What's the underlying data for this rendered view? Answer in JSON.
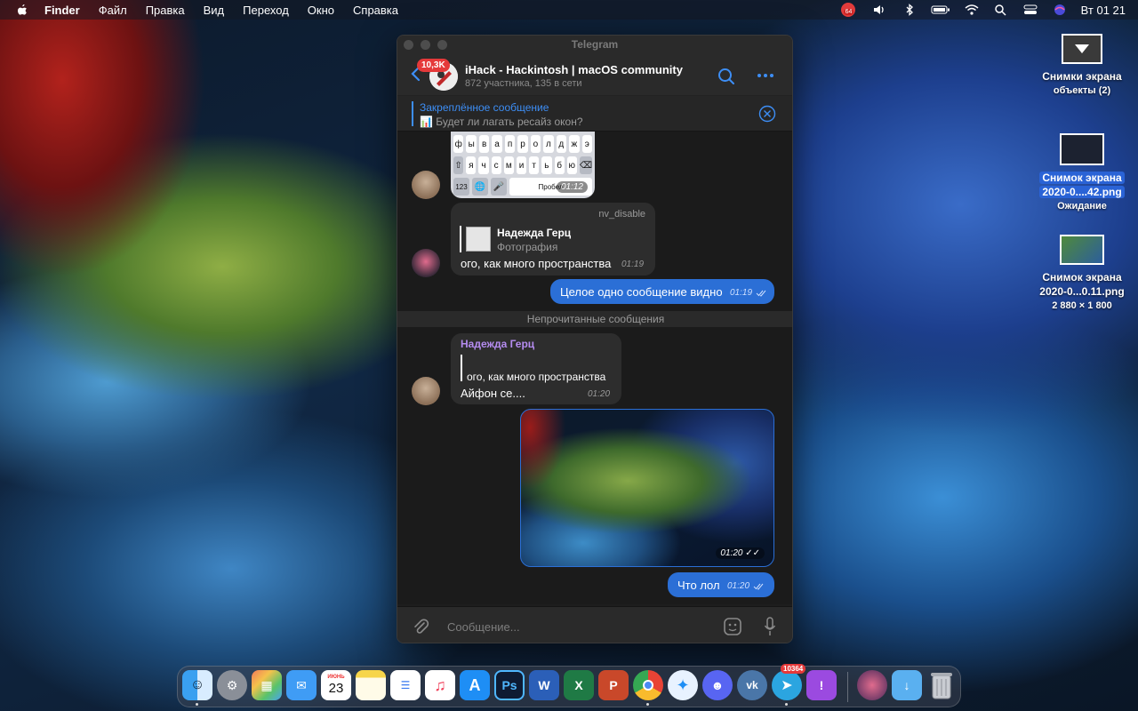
{
  "menubar": {
    "app_name": "Finder",
    "menus": [
      "Файл",
      "Правка",
      "Вид",
      "Переход",
      "Окно",
      "Справка"
    ],
    "badge_count": "64",
    "clock": "Вт 01 21"
  },
  "desktop_icons": [
    {
      "line1": "Снимки экрана",
      "line2": "объекты (2)"
    },
    {
      "line1": "Снимок экрана",
      "line2": "2020-0....42.png",
      "line3": "Ожидание"
    },
    {
      "line1": "Снимок экрана",
      "line2": "2020-0...0.11.png",
      "line3": "2 880 × 1 800"
    }
  ],
  "window": {
    "title": "Telegram",
    "chat_title": "iHack - Hackintosh | macOS community",
    "chat_subtitle": "872 участника, 135 в сети",
    "unread_badge": "10,3K",
    "pinned": {
      "title": "Закреплённое сообщение",
      "emoji": "📊",
      "text": "Будет ли лагать ресайз окон?"
    },
    "keyboard": {
      "row1": [
        "ф",
        "ы",
        "в",
        "а",
        "п",
        "р",
        "о",
        "л",
        "д",
        "ж",
        "э"
      ],
      "row2": [
        "⇧",
        "я",
        "ч",
        "с",
        "м",
        "и",
        "т",
        "ь",
        "б",
        "ю",
        "⌫"
      ],
      "row3": [
        "123",
        "🌐",
        "🎤",
        "Пробел"
      ],
      "time": "01:12"
    },
    "messages": {
      "m1": {
        "forwarded_from": "nv_disable",
        "reply_name": "Надежда Герц",
        "reply_text": "Фотография",
        "text": "ого, как много пространства",
        "time": "01:19"
      },
      "m2": {
        "text": "Целое одно сообщение видно",
        "time": "01:19"
      },
      "unread_label": "Непрочитанные сообщения",
      "m3": {
        "author": "Надежда Герц",
        "quote": "ого, как много пространства",
        "text": "Айфон се....",
        "time": "01:20"
      },
      "photo_time": "01:20",
      "m4": {
        "text": "Что лол",
        "time": "01:20"
      }
    },
    "composer": {
      "placeholder": "Сообщение..."
    }
  },
  "dock": {
    "calendar_month": "ИЮНЬ",
    "calendar_day": "23",
    "telegram_badge": "10364",
    "apps": [
      "finder-icon",
      "system-preferences-icon",
      "launchpad-icon",
      "mail-icon",
      "calendar-icon",
      "notes-icon",
      "reminders-icon",
      "music-icon",
      "app-store-icon",
      "photoshop-icon",
      "word-icon",
      "excel-icon",
      "powerpoint-icon",
      "chrome-icon",
      "safari-icon",
      "discord-icon",
      "vk-icon",
      "telegram-icon",
      "feedback-icon",
      "avatar-app-icon",
      "downloads-folder-icon",
      "trash-icon"
    ],
    "ps_label": "Ps",
    "w_label": "W",
    "x_label": "X",
    "p_label": "P",
    "colors": {
      "telegram": "#2b6fd6",
      "badge": "#e5393a"
    }
  }
}
